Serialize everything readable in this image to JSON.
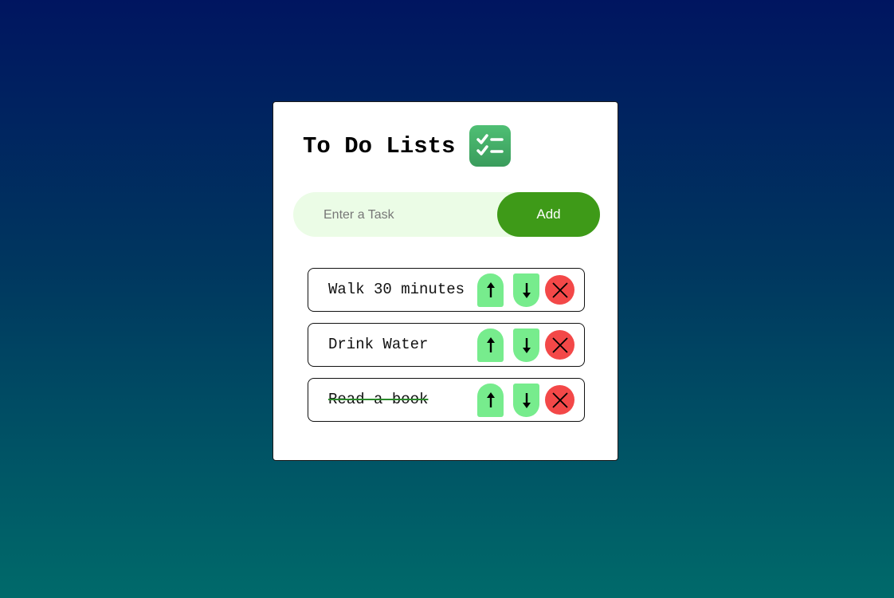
{
  "header": {
    "title": "To Do Lists",
    "icon": "checklist-icon"
  },
  "input": {
    "placeholder": "Enter a Task",
    "value": "",
    "add_label": "Add"
  },
  "tasks": [
    {
      "text": "Walk 30 minutes",
      "completed": false
    },
    {
      "text": "Drink Water",
      "completed": false
    },
    {
      "text": "Read a book",
      "completed": true
    }
  ],
  "colors": {
    "accent": "#3e9a18",
    "move_button": "#77ec8d",
    "delete_button": "#f34848",
    "input_background": "#ebfce6"
  }
}
